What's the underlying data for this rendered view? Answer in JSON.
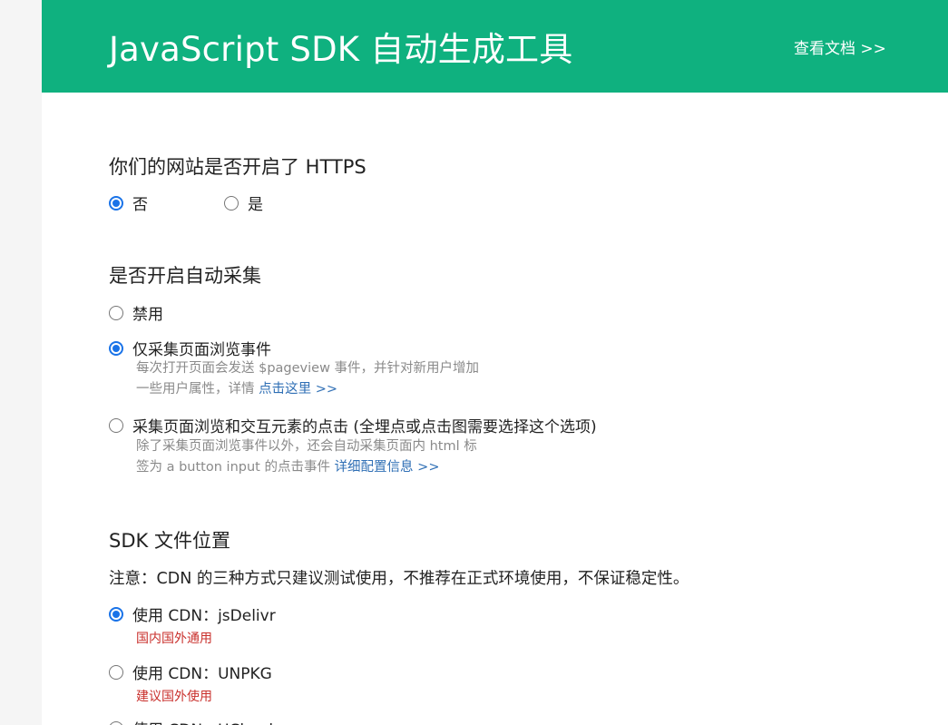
{
  "header": {
    "title": "JavaScript SDK 自动生成工具",
    "docs_link": "查看文档 >>",
    "bg_color": "#0fb17f"
  },
  "https_section": {
    "title": "你们的网站是否开启了 HTTPS",
    "options": [
      {
        "label": "否",
        "checked": true
      },
      {
        "label": "是",
        "checked": false
      }
    ]
  },
  "autotrack_section": {
    "title": "是否开启自动采集",
    "options": [
      {
        "label": "禁用",
        "checked": false
      },
      {
        "label": "仅采集页面浏览事件",
        "checked": true,
        "desc_line1": "每次打开页面会发送 $pageview 事件，并针对新用户增加",
        "desc_line2": "一些用户属性，详情 ",
        "link": "点击这里 >>"
      },
      {
        "label": "采集页面浏览和交互元素的点击 (全埋点或点击图需要选择这个选项)",
        "checked": false,
        "desc_line1": "除了采集页面浏览事件以外，还会自动采集页面内 html 标",
        "desc_line2": "签为 a button input 的点击事件 ",
        "link": "详细配置信息 >>"
      }
    ]
  },
  "sdk_location_section": {
    "title": "SDK 文件位置",
    "note": "注意：CDN 的三种方式只建议测试使用，不推荐在正式环境使用，不保证稳定性。",
    "options": [
      {
        "label": "使用 CDN：jsDelivr",
        "checked": true,
        "tag": "国内国外通用"
      },
      {
        "label": "使用 CDN：UNPKG",
        "checked": false,
        "tag": "建议国外使用"
      },
      {
        "label": "使用 CDN：UCloud",
        "checked": false
      }
    ],
    "accent_color": "#1a73e8",
    "tag_color": "#c9302c"
  }
}
